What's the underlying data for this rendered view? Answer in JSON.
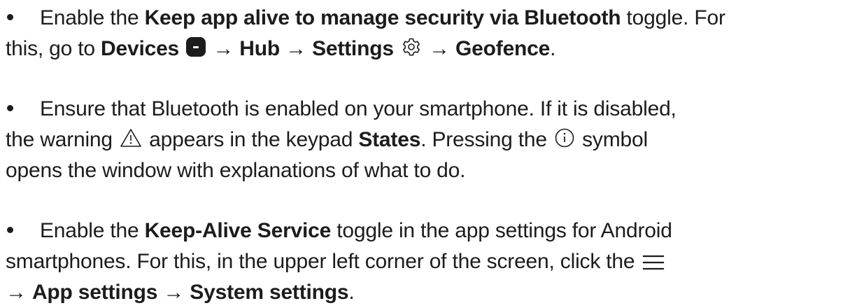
{
  "items": [
    {
      "lines": [
        {
          "t1": "Enable the ",
          "b1": "Keep app alive to manage security via Bluetooth",
          "t2": " toggle. For"
        },
        {
          "t1": "this, go to ",
          "b1": "Devices",
          "arrow1": " → ",
          "b2": "Hub",
          "arrow2": " → ",
          "b3": "Settings",
          "arrow3": " → ",
          "b4": "Geofence",
          "t2": "."
        }
      ]
    },
    {
      "lines": [
        {
          "t1": "Ensure that Bluetooth is enabled on your smartphone. If it is disabled,"
        },
        {
          "t1": "the warning ",
          "t2": " appears in the keypad ",
          "b1": "States",
          "t3": ". Pressing the ",
          "t4": " symbol"
        },
        {
          "t1": "opens the window with explanations of what to do."
        }
      ]
    },
    {
      "lines": [
        {
          "t1": "Enable the ",
          "b1": "Keep-Alive Service",
          "t2": " toggle in the app settings for Android"
        },
        {
          "t1": "smartphones. For this, in the upper left corner of the screen, click the "
        },
        {
          "arrow1": "→ ",
          "b1": "App settings",
          "arrow2": " → ",
          "b2": "System settings",
          "t1": "."
        }
      ]
    }
  ],
  "icons": {
    "devices": "devices-icon",
    "settings": "gear-icon",
    "warning": "warning-icon",
    "info": "info-icon",
    "menu": "menu-icon"
  },
  "colors": {
    "text": "#1c1c1c",
    "background": "#ffffff"
  }
}
